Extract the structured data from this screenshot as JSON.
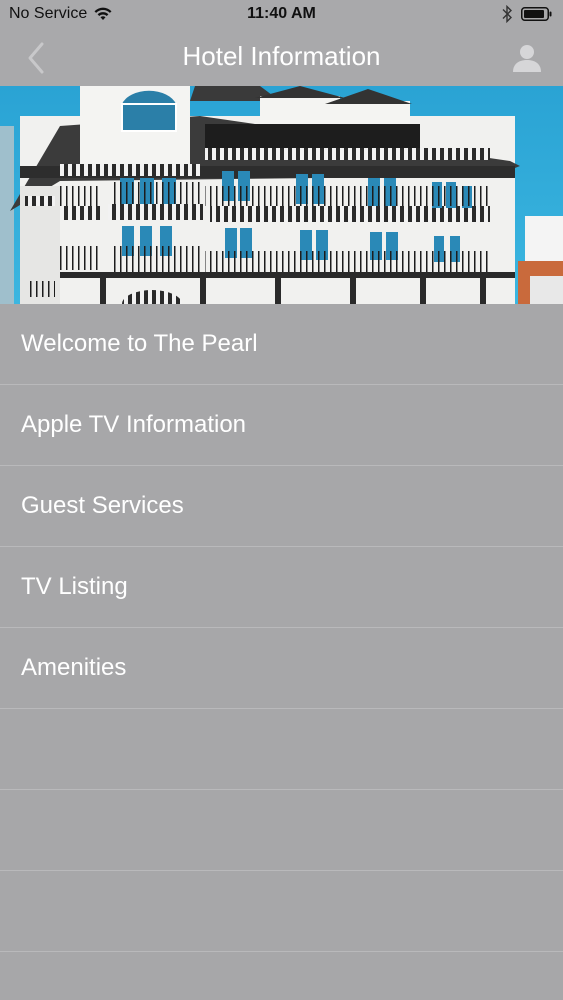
{
  "status_bar": {
    "carrier": "No Service",
    "time": "11:40 AM",
    "icons": [
      "wifi-icon",
      "bluetooth-icon",
      "battery-icon"
    ]
  },
  "nav": {
    "title": "Hotel Information",
    "back_icon": "chevron-left-icon",
    "profile_icon": "user-icon"
  },
  "hero": {
    "image": "hotel-building-photo"
  },
  "menu": {
    "items": [
      {
        "label": "Welcome to The Pearl"
      },
      {
        "label": "Apple TV Information"
      },
      {
        "label": "Guest Services"
      },
      {
        "label": "TV Listing"
      },
      {
        "label": "Amenities"
      }
    ]
  },
  "colors": {
    "background": "#a7a7a9",
    "text": "#ffffff",
    "divider": "#b9b9bb",
    "sky": "#2eaad8"
  }
}
